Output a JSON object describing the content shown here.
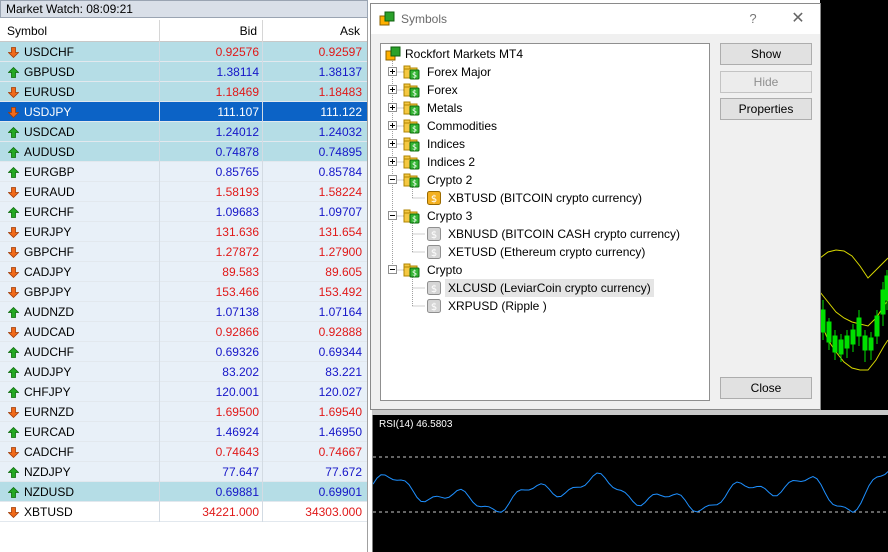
{
  "market_watch": {
    "title": "Market Watch: 08:09:21",
    "columns": {
      "symbol": "Symbol",
      "bid": "Bid",
      "ask": "Ask"
    },
    "rows": [
      {
        "symbol": "USDCHF",
        "bid": "0.92576",
        "ask": "0.92597",
        "dir": "down",
        "tint": "t1"
      },
      {
        "symbol": "GBPUSD",
        "bid": "1.38114",
        "ask": "1.38137",
        "dir": "up",
        "tint": "t1"
      },
      {
        "symbol": "EURUSD",
        "bid": "1.18469",
        "ask": "1.18483",
        "dir": "down",
        "tint": "t1"
      },
      {
        "symbol": "USDJPY",
        "bid": "111.107",
        "ask": "111.122",
        "dir": "down",
        "tint": "sel"
      },
      {
        "symbol": "USDCAD",
        "bid": "1.24012",
        "ask": "1.24032",
        "dir": "up",
        "tint": "t1"
      },
      {
        "symbol": "AUDUSD",
        "bid": "0.74878",
        "ask": "0.74895",
        "dir": "up",
        "tint": "t1"
      },
      {
        "symbol": "EURGBP",
        "bid": "0.85765",
        "ask": "0.85784",
        "dir": "up",
        "tint": "t2"
      },
      {
        "symbol": "EURAUD",
        "bid": "1.58193",
        "ask": "1.58224",
        "dir": "down",
        "tint": "t2"
      },
      {
        "symbol": "EURCHF",
        "bid": "1.09683",
        "ask": "1.09707",
        "dir": "up",
        "tint": "t2"
      },
      {
        "symbol": "EURJPY",
        "bid": "131.636",
        "ask": "131.654",
        "dir": "down",
        "tint": "t2"
      },
      {
        "symbol": "GBPCHF",
        "bid": "1.27872",
        "ask": "1.27900",
        "dir": "down",
        "tint": "t2"
      },
      {
        "symbol": "CADJPY",
        "bid": "89.583",
        "ask": "89.605",
        "dir": "down",
        "tint": "t2"
      },
      {
        "symbol": "GBPJPY",
        "bid": "153.466",
        "ask": "153.492",
        "dir": "down",
        "tint": "t2"
      },
      {
        "symbol": "AUDNZD",
        "bid": "1.07138",
        "ask": "1.07164",
        "dir": "up",
        "tint": "t2"
      },
      {
        "symbol": "AUDCAD",
        "bid": "0.92866",
        "ask": "0.92888",
        "dir": "down",
        "tint": "t2"
      },
      {
        "symbol": "AUDCHF",
        "bid": "0.69326",
        "ask": "0.69344",
        "dir": "up",
        "tint": "t2"
      },
      {
        "symbol": "AUDJPY",
        "bid": "83.202",
        "ask": "83.221",
        "dir": "up",
        "tint": "t2"
      },
      {
        "symbol": "CHFJPY",
        "bid": "120.001",
        "ask": "120.027",
        "dir": "up",
        "tint": "t2"
      },
      {
        "symbol": "EURNZD",
        "bid": "1.69500",
        "ask": "1.69540",
        "dir": "down",
        "tint": "t2"
      },
      {
        "symbol": "EURCAD",
        "bid": "1.46924",
        "ask": "1.46950",
        "dir": "up",
        "tint": "t2"
      },
      {
        "symbol": "CADCHF",
        "bid": "0.74643",
        "ask": "0.74667",
        "dir": "down",
        "tint": "t2"
      },
      {
        "symbol": "NZDJPY",
        "bid": "77.647",
        "ask": "77.672",
        "dir": "up",
        "tint": "t2"
      },
      {
        "symbol": "NZDUSD",
        "bid": "0.69881",
        "ask": "0.69901",
        "dir": "up",
        "tint": "t1"
      },
      {
        "symbol": "XBTUSD",
        "bid": "34221.000",
        "ask": "34303.000",
        "dir": "down",
        "tint": "t3"
      }
    ]
  },
  "symbols_dialog": {
    "title": "Symbols",
    "help_glyph": "?",
    "close_glyph": "✕",
    "tree": {
      "root": "Rockfort Markets MT4",
      "groups": [
        {
          "label": "Forex Major",
          "expanded": false,
          "children": []
        },
        {
          "label": "Forex",
          "expanded": false,
          "children": []
        },
        {
          "label": "Metals",
          "expanded": false,
          "children": []
        },
        {
          "label": "Commodities",
          "expanded": false,
          "children": []
        },
        {
          "label": "Indices",
          "expanded": false,
          "children": []
        },
        {
          "label": "Indices 2",
          "expanded": false,
          "children": []
        },
        {
          "label": "Crypto 2",
          "expanded": true,
          "children": [
            {
              "label": "XBTUSD  (BITCOIN crypto currency)",
              "active": true
            }
          ]
        },
        {
          "label": "Crypto 3",
          "expanded": true,
          "children": [
            {
              "label": "XBNUSD  (BITCOIN CASH crypto currency)",
              "active": false
            },
            {
              "label": "XETUSD  (Ethereum crypto currency)",
              "active": false
            }
          ]
        },
        {
          "label": "Crypto",
          "expanded": true,
          "children": [
            {
              "label": "XLCUSD  (LeviarCoin crypto currency)",
              "active": false,
              "highlight": true
            },
            {
              "label": "XRPUSD  (Ripple )",
              "active": false
            }
          ]
        }
      ]
    },
    "buttons": {
      "show": "Show",
      "hide": "Hide",
      "properties": "Properties",
      "close": "Close"
    }
  },
  "rsi_panel": {
    "label": "RSI(14) 46.5803"
  },
  "colors": {
    "up": "#1515c8",
    "down": "#e01818",
    "selected": "#0c63c6",
    "chart_bg": "#000000",
    "rsi_line": "#1e90ff",
    "bands": "#d8d800",
    "candles": "#00e000"
  },
  "icons": {
    "up_arrow": "green-up-arrow-icon",
    "down_arrow": "orange-down-arrow-icon",
    "symbols_window": "symbols-app-icon",
    "folder": "folder-icon",
    "symbol": "symbol-dollar-icon"
  }
}
